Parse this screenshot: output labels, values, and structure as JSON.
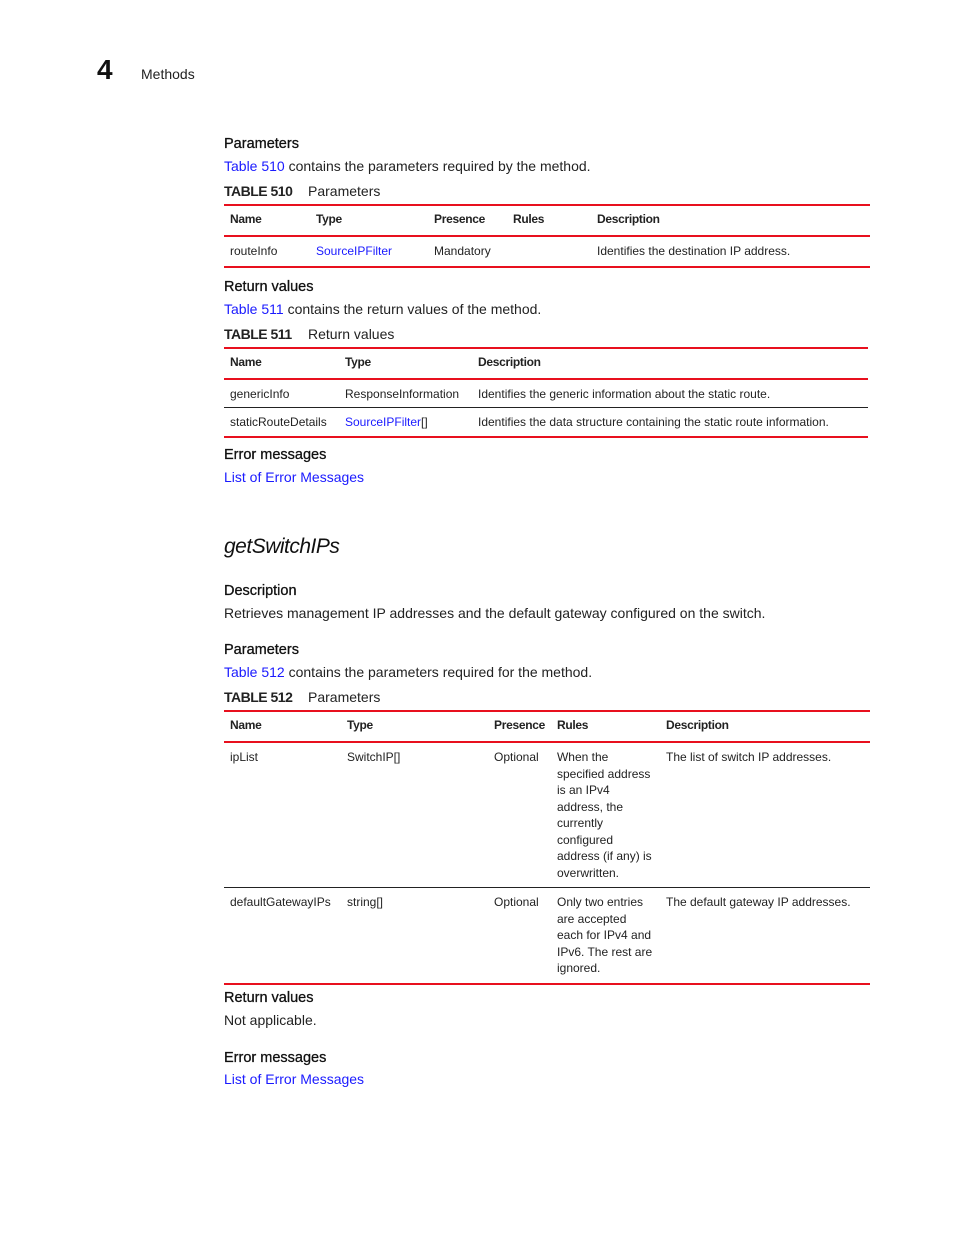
{
  "header": {
    "chapter_number": "4",
    "chapter_title": "Methods"
  },
  "section1": {
    "parameters_heading": "Parameters",
    "parameters_intro_link": "Table 510",
    "parameters_intro_text": " contains the parameters required by the method.",
    "table510": {
      "label": "TABLE 510",
      "caption": "Parameters",
      "columns": [
        "Name",
        "Type",
        "Presence",
        "Rules",
        "Description"
      ],
      "rows": [
        {
          "name": "routeInfo",
          "type": "SourceIPFilter",
          "type_suffix": "",
          "presence": "Mandatory",
          "rules": "",
          "description": "Identifies the destination IP address."
        }
      ]
    },
    "return_heading": "Return values",
    "return_intro_link": "Table 511",
    "return_intro_text": " contains the return values of the method.",
    "table511": {
      "label": "TABLE 511",
      "caption": "Return values",
      "columns": [
        "Name",
        "Type",
        "Description"
      ],
      "rows": [
        {
          "name": "genericInfo",
          "type": "ResponseInformation",
          "description": "Identifies the generic information about the static route."
        },
        {
          "name": "staticRouteDetails",
          "type": "SourceIPFilter",
          "type_suffix": "[]",
          "description": "Identifies the data structure containing the static route information."
        }
      ]
    },
    "error_heading": "Error messages",
    "error_link": "List of Error Messages"
  },
  "section2": {
    "method_title": "getSwitchIPs",
    "description_heading": "Description",
    "description_text": "Retrieves management IP addresses and the default gateway configured on the switch.",
    "parameters_heading": "Parameters",
    "parameters_intro_link": "Table 512",
    "parameters_intro_text": " contains the parameters required for the method.",
    "table512": {
      "label": "TABLE 512",
      "caption": "Parameters",
      "columns": [
        "Name",
        "Type",
        "Presence",
        "Rules",
        "Description"
      ],
      "rows": [
        {
          "name": "ipList",
          "type": "SwitchIP[]",
          "presence": "Optional",
          "rules": "When the specified address is an IPv4 address, the currently configured address (if any) is overwritten.",
          "description": "The list of switch IP addresses."
        },
        {
          "name": "defaultGatewayIPs",
          "type": "string[]",
          "presence": "Optional",
          "rules": "Only two entries are accepted each for IPv4 and IPv6. The rest are ignored.",
          "description": "The default gateway IP addresses."
        }
      ]
    },
    "return_heading": "Return values",
    "return_text": "Not applicable.",
    "error_heading": "Error messages",
    "error_link": "List of Error Messages"
  }
}
